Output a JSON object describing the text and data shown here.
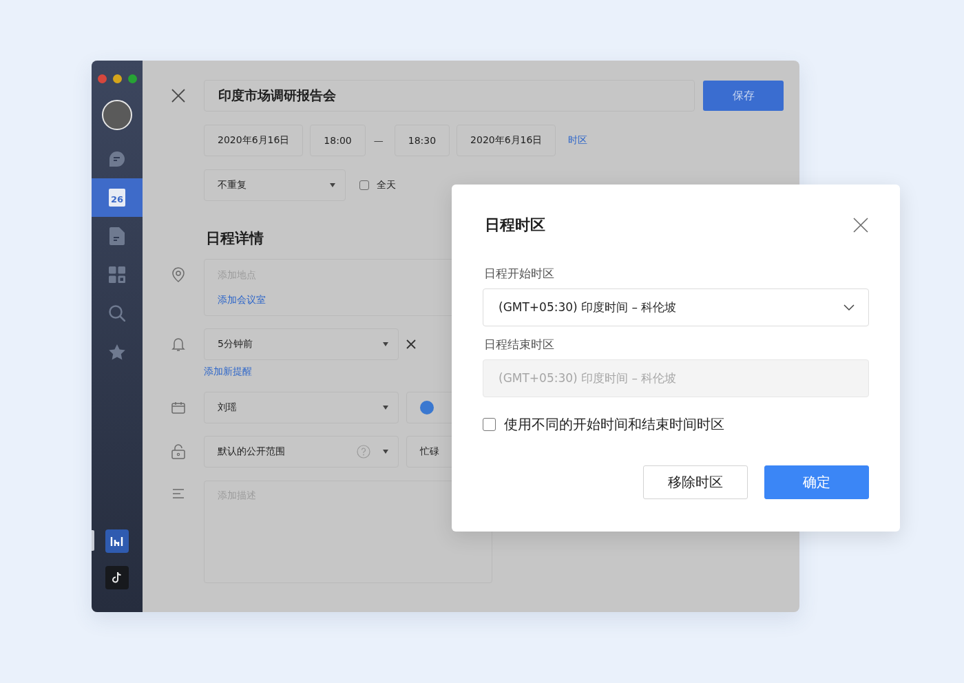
{
  "sidebar": {
    "nav": [
      {
        "kind": "chat",
        "selected": false
      },
      {
        "kind": "calendar",
        "label": "26",
        "selected": true
      },
      {
        "kind": "document",
        "selected": false
      },
      {
        "kind": "apps",
        "selected": false
      },
      {
        "kind": "search",
        "selected": false
      },
      {
        "kind": "star",
        "selected": false
      }
    ],
    "apps": [
      {
        "kind": "chart"
      },
      {
        "kind": "music"
      }
    ]
  },
  "editor": {
    "title": "印度市场调研报告会",
    "save_button": "保存",
    "start_date": "2020年6月16日",
    "start_time": "18:00",
    "separator": "—",
    "end_time": "18:30",
    "end_date": "2020年6月16日",
    "timezone_link": "时区",
    "repeat": "不重复",
    "all_day": {
      "label": "全天",
      "checked": false
    },
    "section_heading": "日程详情",
    "location": {
      "placeholder": "添加地点",
      "add_room": "添加会议室"
    },
    "reminder": {
      "value": "5分钟前",
      "add": "添加新提醒"
    },
    "calendar": {
      "value": "刘瑶",
      "color": "#3a78d0"
    },
    "privacy": {
      "value": "默认的公开范围",
      "availability": "忙碌"
    },
    "description": {
      "placeholder": "添加描述"
    }
  },
  "dialog": {
    "title": "日程时区",
    "start_label": "日程开始时区",
    "start_value": "(GMT+05:30) 印度时间 – 科伦坡",
    "end_label": "日程结束时区",
    "end_value": "(GMT+05:30) 印度时间 – 科伦坡",
    "end_disabled": true,
    "different_zones": {
      "label": "使用不同的开始时间和结束时间时区",
      "checked": false
    },
    "buttons": [
      {
        "label": "移除时区",
        "kind": "secondary"
      },
      {
        "label": "确定",
        "kind": "primary"
      }
    ]
  }
}
